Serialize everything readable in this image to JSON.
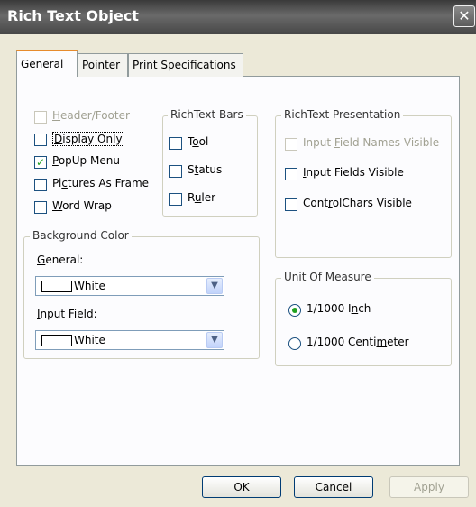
{
  "window": {
    "title": "Rich Text Object",
    "close_glyph": "✕"
  },
  "tabs": [
    "General",
    "Pointer",
    "Print Specifications"
  ],
  "left_checks": [
    {
      "pre": "",
      "u": "H",
      "post": "eader/Footer",
      "checked": false,
      "disabled": true
    },
    {
      "pre": "",
      "u": "D",
      "post": "isplay Only",
      "checked": false,
      "disabled": false
    },
    {
      "pre": "",
      "u": "P",
      "post": "opUp Menu",
      "checked": true,
      "disabled": false
    },
    {
      "pre": "Pi",
      "u": "c",
      "post": "tures As Frame",
      "checked": false,
      "disabled": false
    },
    {
      "pre": "",
      "u": "W",
      "post": "ord Wrap",
      "checked": false,
      "disabled": false
    }
  ],
  "richtext_bars": {
    "legend": "RichText Bars",
    "items": [
      {
        "pre": "T",
        "u": "o",
        "post": "ol"
      },
      {
        "pre": "S",
        "u": "t",
        "post": "atus"
      },
      {
        "pre": "R",
        "u": "u",
        "post": "ler"
      }
    ]
  },
  "presentation": {
    "legend": "RichText Presentation",
    "items": [
      {
        "pre": "Input ",
        "u": "F",
        "post": "ield Names Visible",
        "checked": false,
        "disabled": true
      },
      {
        "pre": "",
        "u": "I",
        "post": "nput Fields Visible",
        "checked": false,
        "disabled": false
      },
      {
        "pre": "Cont",
        "u": "r",
        "post": "olChars Visible",
        "checked": false,
        "disabled": false
      }
    ]
  },
  "background": {
    "legend": "Background Color",
    "general_label_u": "G",
    "general_label_rest": "eneral:",
    "general_value": "White",
    "input_label_u": "I",
    "input_label_rest": "nput Field:",
    "input_value": "White"
  },
  "unit": {
    "legend": "Unit Of Measure",
    "items": [
      {
        "pre": "1/1000 I",
        "u": "n",
        "post": "ch",
        "selected": true
      },
      {
        "pre": "1/1000 Centi",
        "u": "m",
        "post": "eter",
        "selected": false
      }
    ]
  },
  "buttons": {
    "ok": "OK",
    "cancel": "Cancel",
    "apply": "Apply"
  },
  "colors": {
    "check": "#21a121",
    "tab_accent": "#e68b2c"
  }
}
